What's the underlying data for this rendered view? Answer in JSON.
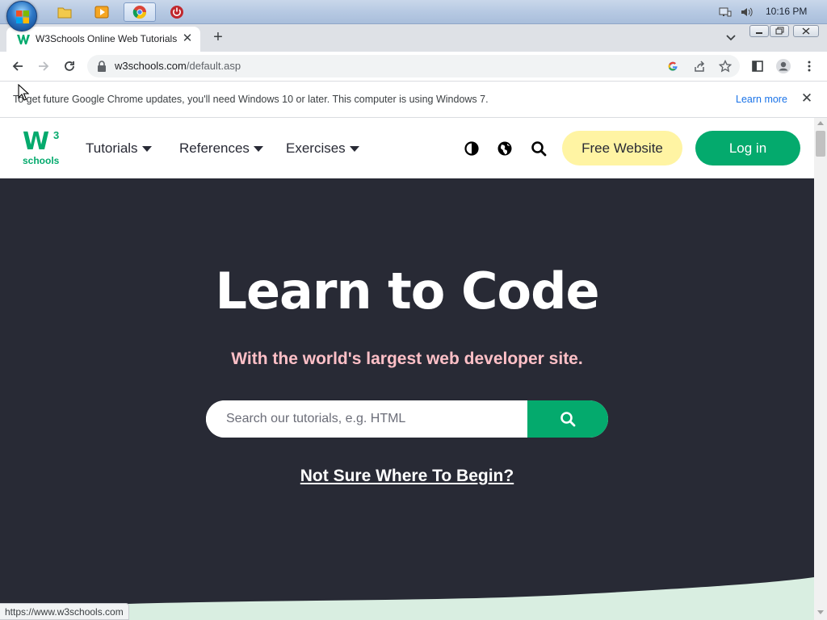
{
  "taskbar": {
    "clock": "10:16 PM"
  },
  "browser": {
    "tab": {
      "title": "W3Schools Online Web Tutorials",
      "favicon": "w3schools-favicon"
    },
    "address_bar": {
      "host": "w3schools.com",
      "path": "/default.asp"
    },
    "infobar": {
      "message": "To get future Google Chrome updates, you'll need Windows 10 or later. This computer is using Windows 7.",
      "learn_more": "Learn more"
    },
    "status_url": "https://www.w3schools.com"
  },
  "site": {
    "logo": {
      "mark": "W",
      "superscript": "3",
      "word": "schools"
    },
    "nav": [
      {
        "label": "Tutorials"
      },
      {
        "label": "References"
      },
      {
        "label": "Exercises"
      }
    ],
    "free_website_label": "Free Website",
    "login_label": "Log in",
    "hero": {
      "title": "Learn to Code",
      "subtitle": "With the world's largest web developer site.",
      "search_placeholder": "Search our tutorials, e.g. HTML",
      "not_sure_link": "Not Sure Where To Begin?"
    }
  },
  "colors": {
    "brand_green": "#04aa6d",
    "hero_bg": "#282a35",
    "subtitle_pink": "#ffc0c7",
    "free_btn_yellow": "#fff4a3"
  },
  "icons": {
    "taskbar": [
      "windows-start-orb",
      "file-explorer-icon",
      "media-player-icon",
      "chrome-icon",
      "power-app-icon"
    ],
    "tray": [
      "network-icon",
      "volume-icon"
    ],
    "toolbar": [
      "back-arrow-icon",
      "forward-arrow-icon",
      "reload-icon",
      "lock-icon",
      "google-lens-icon",
      "share-icon",
      "bookmark-star-icon",
      "side-panel-icon",
      "profile-icon",
      "kebab-menu-icon"
    ],
    "site_nav": [
      "contrast-icon",
      "globe-icon",
      "search-icon"
    ]
  }
}
